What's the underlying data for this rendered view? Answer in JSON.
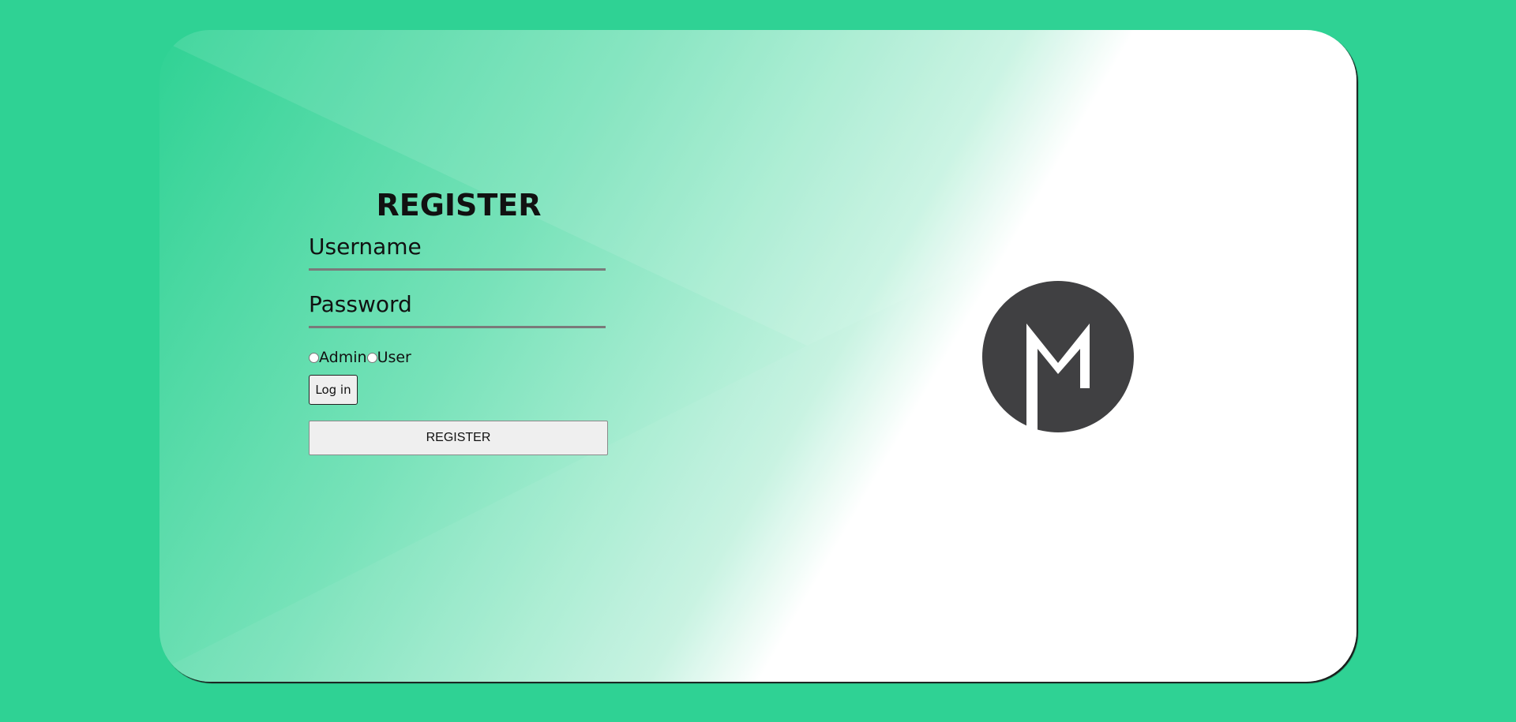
{
  "register_form": {
    "title": "REGISTER",
    "username_placeholder": "Username",
    "password_placeholder": "Password",
    "roles": [
      {
        "label": "Admin",
        "checked": false
      },
      {
        "label": "User",
        "checked": false
      }
    ],
    "login_label": "Log in",
    "register_label": "REGISTER"
  },
  "logo": {
    "icon": "m-monogram-icon",
    "letter": "M",
    "circle_color": "#404042",
    "letter_color": "#ffffff"
  },
  "colors": {
    "background": "#2fd294",
    "card_gradient_start": "#2fd294",
    "card_gradient_end": "#ffffff"
  }
}
